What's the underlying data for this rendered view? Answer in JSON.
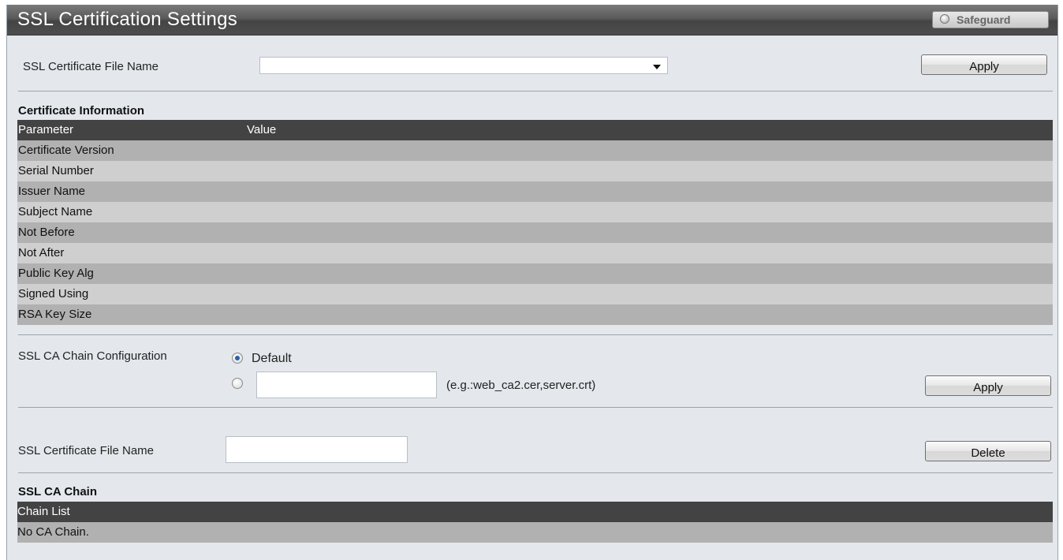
{
  "window": {
    "title": "SSL Certification Settings",
    "safeguard_label": "Safeguard"
  },
  "cert_select": {
    "label": "SSL Certificate File Name",
    "value": "",
    "apply_label": "Apply"
  },
  "cert_info": {
    "title": "Certificate Information",
    "headers": [
      "Parameter",
      "Value"
    ],
    "rows": [
      [
        "Certificate Version",
        ""
      ],
      [
        "Serial Number",
        ""
      ],
      [
        "Issuer Name",
        ""
      ],
      [
        "Subject Name",
        ""
      ],
      [
        "Not Before",
        ""
      ],
      [
        "Not After",
        ""
      ],
      [
        "Public Key Alg",
        ""
      ],
      [
        "Signed Using",
        ""
      ],
      [
        "RSA Key Size",
        ""
      ]
    ]
  },
  "ca_chain_config": {
    "label": "SSL CA Chain Configuration",
    "option_default": "Default",
    "selected": "default",
    "custom_value": "",
    "hint": "(e.g.:web_ca2.cer,server.crt)",
    "apply_label": "Apply"
  },
  "delete_cert": {
    "label": "SSL Certificate File Name",
    "value": "",
    "delete_label": "Delete"
  },
  "ca_chain": {
    "title": "SSL CA Chain",
    "header": "Chain List",
    "rows": [
      "No CA Chain."
    ]
  },
  "colors": {
    "header_row": "#434343",
    "row_dark": "#b1b1b1",
    "row_light": "#cfcfcf",
    "panel_bg": "#e4e8ed"
  }
}
